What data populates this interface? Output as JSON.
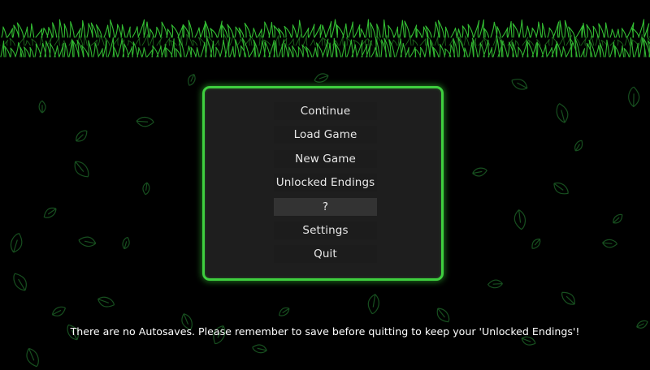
{
  "menu": {
    "items": [
      {
        "id": "continue",
        "label": "Continue"
      },
      {
        "id": "load-game",
        "label": "Load Game"
      },
      {
        "id": "new-game",
        "label": "New Game"
      },
      {
        "id": "unlocked-endings",
        "label": "Unlocked Endings"
      },
      {
        "id": "question",
        "label": "?"
      },
      {
        "id": "settings",
        "label": "Settings"
      },
      {
        "id": "quit",
        "label": "Quit"
      }
    ],
    "selected_index": 4
  },
  "notice": "There are no Autosaves. Please remember to save before quitting to keep your 'Unlocked Endings'!",
  "colors": {
    "background": "#000000",
    "panel": "#1e1e1e",
    "panel_border": "#3fcf3f",
    "grass": "#36c836",
    "leaf_outline": "#1f6a2a",
    "menu_text": "#e8e8e8",
    "selected_item": "#333333"
  },
  "icons": [
    "grass-border",
    "leaf-outline-icon"
  ]
}
